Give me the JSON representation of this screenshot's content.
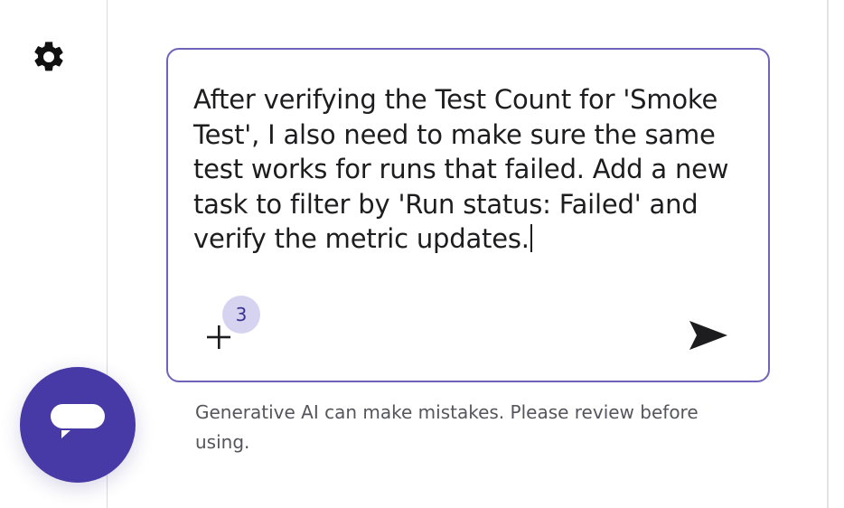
{
  "composer": {
    "prompt_text": "After verifying the Test Count for 'Smoke Test', I also need to make sure the same test works for runs that failed. Add a new task to filter by 'Run status: Failed' and verify the metric updates.",
    "attachment_count": "3"
  },
  "footer": {
    "disclaimer": "Generative AI can make mistakes. Please review before using."
  },
  "icons": {
    "settings": "gear-icon",
    "chat": "chat-bubble-icon",
    "attach": "plus-icon",
    "send": "send-icon"
  },
  "colors": {
    "accent": "#473aa7",
    "composer_border": "#6e65bb",
    "badge_bg": "#d6d3f1",
    "badge_text": "#3b3490",
    "text": "#1d1d1f",
    "muted_text": "#55555d"
  }
}
